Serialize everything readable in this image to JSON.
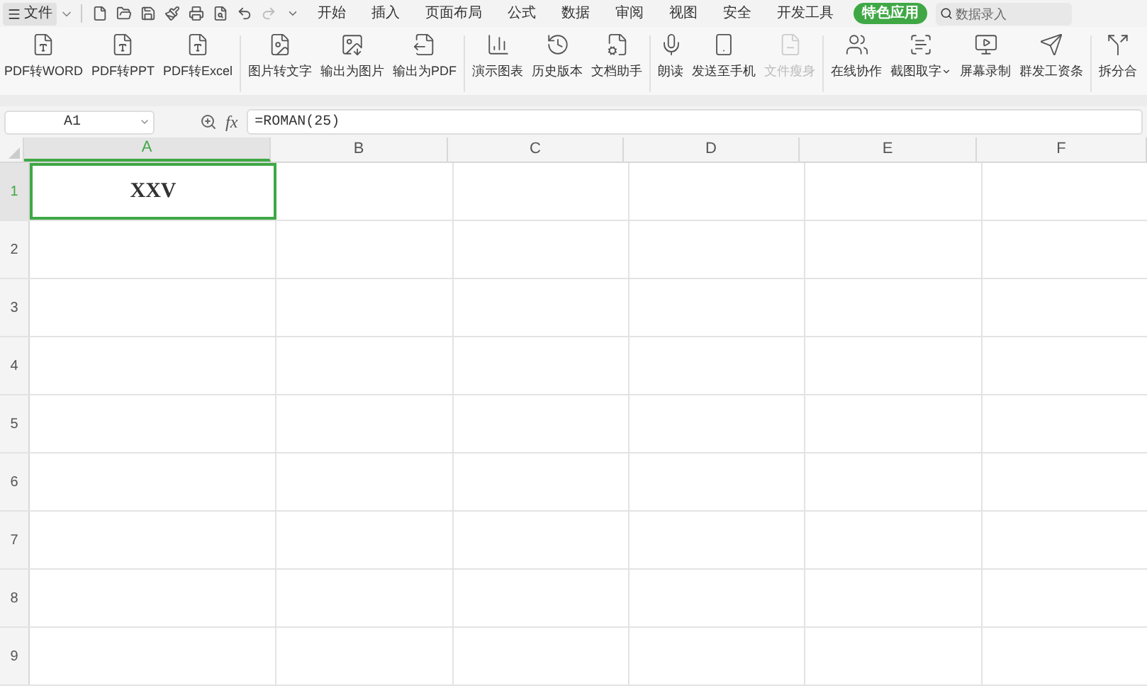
{
  "menu_bar": {
    "file_menu": "文件",
    "tabs": [
      {
        "label": "开始",
        "selected": false
      },
      {
        "label": "插入",
        "selected": false
      },
      {
        "label": "页面布局",
        "selected": false
      },
      {
        "label": "公式",
        "selected": false
      },
      {
        "label": "数据",
        "selected": false
      },
      {
        "label": "审阅",
        "selected": false
      },
      {
        "label": "视图",
        "selected": false
      },
      {
        "label": "安全",
        "selected": false
      },
      {
        "label": "开发工具",
        "selected": false
      },
      {
        "label": "特色应用",
        "selected": true
      }
    ],
    "search": {
      "placeholder": "数据录入"
    }
  },
  "ribbon": {
    "groups": [
      {
        "items": [
          {
            "label": "PDF转WORD",
            "disabled": false,
            "dropdown": false
          },
          {
            "label": "PDF转PPT",
            "disabled": false,
            "dropdown": false
          },
          {
            "label": "PDF转Excel",
            "disabled": false,
            "dropdown": false
          }
        ]
      },
      {
        "items": [
          {
            "label": "图片转文字",
            "disabled": false,
            "dropdown": false
          },
          {
            "label": "输出为图片",
            "disabled": false,
            "dropdown": false
          },
          {
            "label": "输出为PDF",
            "disabled": false,
            "dropdown": false
          }
        ]
      },
      {
        "items": [
          {
            "label": "演示图表",
            "disabled": false,
            "dropdown": false
          },
          {
            "label": "历史版本",
            "disabled": false,
            "dropdown": false
          },
          {
            "label": "文档助手",
            "disabled": false,
            "dropdown": false
          }
        ]
      },
      {
        "items": [
          {
            "label": "朗读",
            "disabled": false,
            "dropdown": false
          },
          {
            "label": "发送至手机",
            "disabled": false,
            "dropdown": false
          },
          {
            "label": "文件瘦身",
            "disabled": true,
            "dropdown": false
          }
        ]
      },
      {
        "items": [
          {
            "label": "在线协作",
            "disabled": false,
            "dropdown": false
          },
          {
            "label": "截图取字",
            "disabled": false,
            "dropdown": true
          },
          {
            "label": "屏幕录制",
            "disabled": false,
            "dropdown": false
          },
          {
            "label": "群发工资条",
            "disabled": false,
            "dropdown": false
          }
        ]
      },
      {
        "items": [
          {
            "label": "拆分合",
            "disabled": false,
            "dropdown": false
          }
        ]
      }
    ]
  },
  "formula_bar": {
    "name_box": "A1",
    "fx": "fx",
    "formula": "=ROMAN(25)"
  },
  "sheet": {
    "columns": [
      {
        "label": "A",
        "selected": true
      },
      {
        "label": "B",
        "selected": false
      },
      {
        "label": "C",
        "selected": false
      },
      {
        "label": "D",
        "selected": false
      },
      {
        "label": "E",
        "selected": false
      },
      {
        "label": "F",
        "selected": false
      }
    ],
    "rows": [
      {
        "label": "1",
        "selected": true,
        "cells": [
          {
            "text": "XXV",
            "selected": true
          }
        ]
      },
      {
        "label": "2",
        "selected": false
      },
      {
        "label": "3",
        "selected": false
      },
      {
        "label": "4",
        "selected": false
      },
      {
        "label": "5",
        "selected": false
      },
      {
        "label": "6",
        "selected": false
      },
      {
        "label": "7",
        "selected": false
      },
      {
        "label": "8",
        "selected": false
      },
      {
        "label": "9",
        "selected": false
      }
    ]
  }
}
